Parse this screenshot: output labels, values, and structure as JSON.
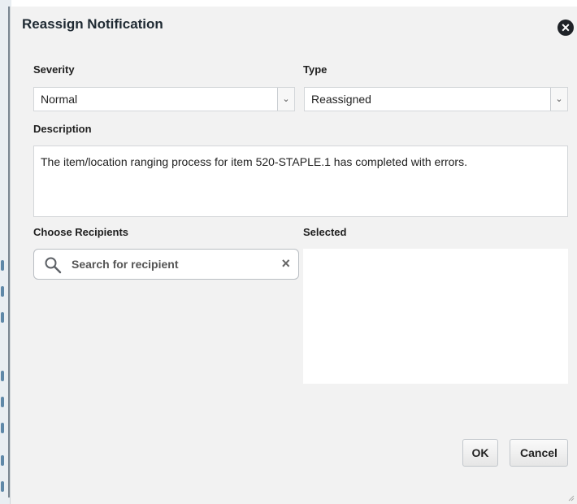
{
  "dialog": {
    "title": "Reassign Notification",
    "close_icon": "close-circle-icon"
  },
  "severity": {
    "label": "Severity",
    "value": "Normal"
  },
  "type": {
    "label": "Type",
    "value": "Reassigned"
  },
  "description": {
    "label": "Description",
    "value": "The item/location ranging process for item 520-STAPLE.1 has completed with errors."
  },
  "recipients": {
    "label": "Choose Recipients",
    "search_placeholder": "Search for recipient",
    "search_icon": "magnifier-icon",
    "clear_icon": "clear-icon"
  },
  "selected": {
    "label": "Selected"
  },
  "buttons": {
    "ok": "OK",
    "cancel": "Cancel"
  }
}
